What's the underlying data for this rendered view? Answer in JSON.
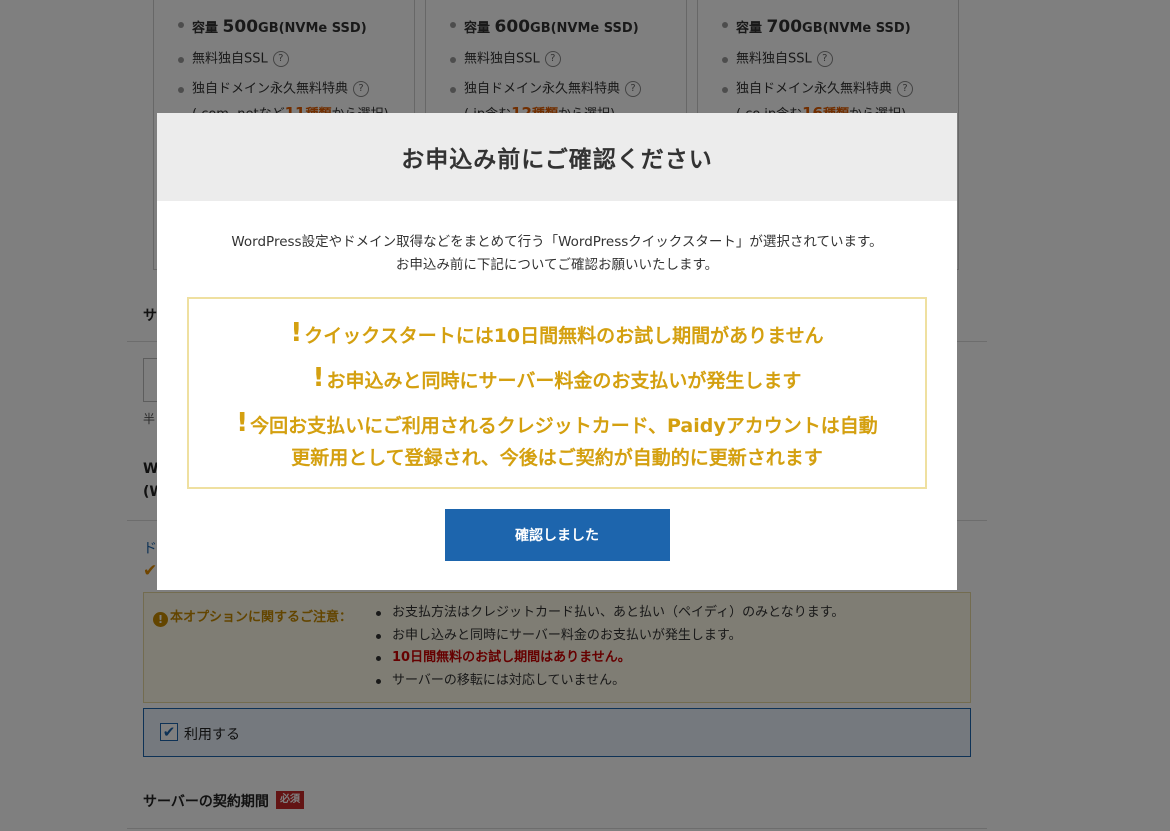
{
  "plans": [
    {
      "capacity_prefix": "容量 ",
      "capacity_value": "500",
      "capacity_suffix": "GB(NVMe SSD)",
      "ssl": "無料独自SSL",
      "domain_title": "独自ドメイン永久無料特典",
      "domain_note_a": "(.com .netなど",
      "domain_count": "11",
      "domain_count_unit": "種類",
      "domain_note_b": "から選択)"
    },
    {
      "capacity_prefix": "容量 ",
      "capacity_value": "600",
      "capacity_suffix": "GB(NVMe SSD)",
      "ssl": "無料独自SSL",
      "domain_title": "独自ドメイン永久無料特典",
      "domain_note_a": "(.jp含む",
      "domain_count": "12",
      "domain_count_unit": "種類",
      "domain_note_b": "から選択)"
    },
    {
      "capacity_prefix": "容量 ",
      "capacity_value": "700",
      "capacity_suffix": "GB(NVMe SSD)",
      "ssl": "無料独自SSL",
      "domain_title": "独自ドメイン永久無料特典",
      "domain_note_a": "(.co.jp含む",
      "domain_count": "16",
      "domain_count_unit": "種類",
      "domain_note_b": "から選択)"
    }
  ],
  "help_icon": "?",
  "background": {
    "section_sa": "サ",
    "hint_partial": "半",
    "w_label": "W",
    "w_label2": "(W",
    "link_partial": "ド",
    "notice_head": "本オプションに関するご注意：",
    "notice_items": [
      "お支払方法はクレジットカード払い、あと払い（ペイディ）のみとなります。",
      "お申し込みと同時にサーバー料金のお支払いが発生します。",
      "10日間無料のお試し期間はありません。",
      "サーバーの移転には対応していません。"
    ],
    "use_label": "利用する",
    "period_label": "サーバーの契約期間",
    "required_badge": "必須"
  },
  "modal": {
    "title": "お申込み前にご確認ください",
    "desc_line1": "WordPress設定やドメイン取得などをまとめて行う「WordPressクイックスタート」が選択されています。",
    "desc_line2": "お申込み前に下記についてご確認お願いいたします。",
    "warnings": [
      "クイックスタートには10日間無料のお試し期間がありません",
      "お申込みと同時にサーバー料金のお支払いが発生します",
      "今回お支払いにご利用されるクレジットカード、Paidyアカウントは自動"
    ],
    "warning3_cont": "更新用として登録され、今後はご契約が自動的に更新されます",
    "confirm_button": "確認しました"
  },
  "colors": {
    "accent_blue": "#1d65ad",
    "warning_gold": "#d4a010",
    "highlight_orange": "#e25d00",
    "required_red": "#c62828"
  }
}
